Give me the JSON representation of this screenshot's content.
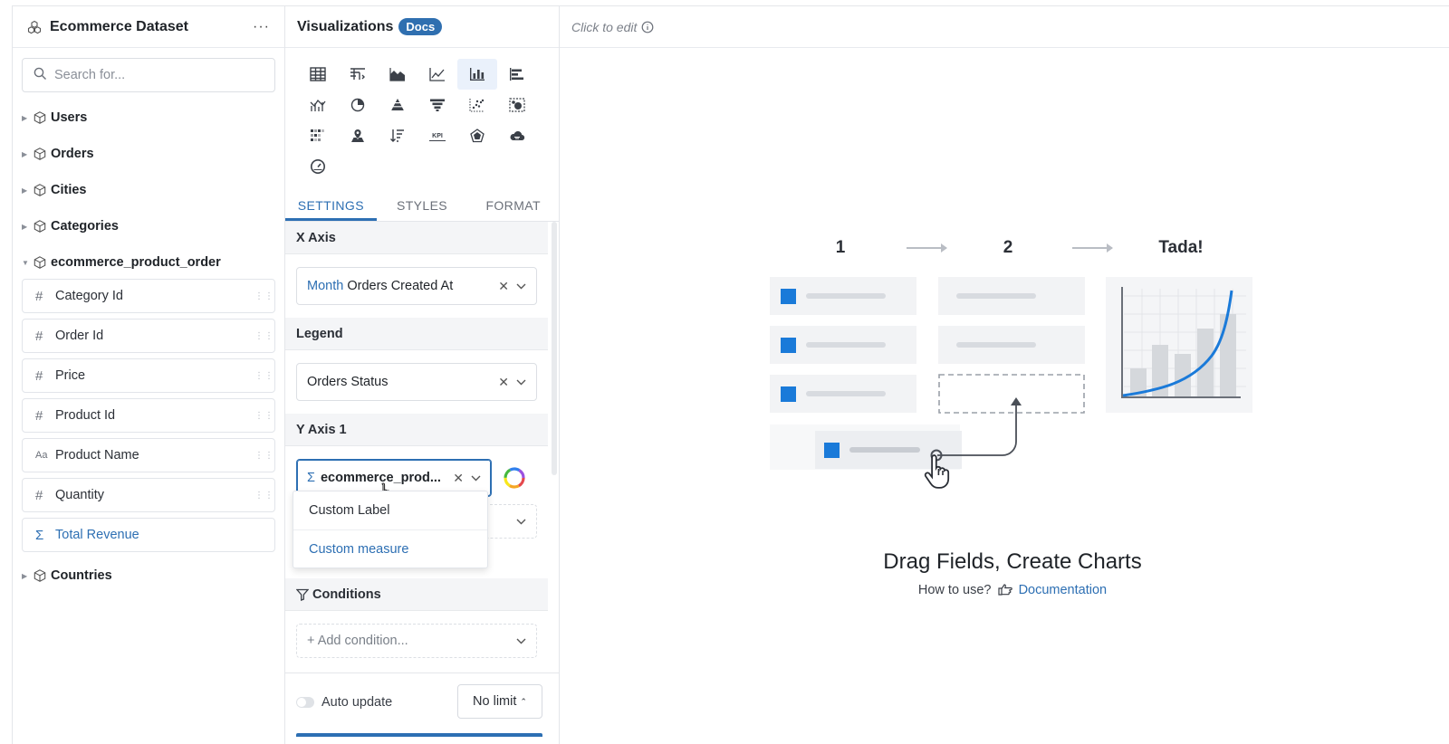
{
  "dataset": {
    "title": "Ecommerce Dataset",
    "more": "···",
    "search_placeholder": "Search for...",
    "models": [
      "Users",
      "Orders",
      "Cities",
      "Categories"
    ],
    "expanded_model": "ecommerce_product_order",
    "fields": [
      {
        "type": "#",
        "label": "Category Id"
      },
      {
        "type": "#",
        "label": "Order Id"
      },
      {
        "type": "#",
        "label": "Price"
      },
      {
        "type": "#",
        "label": "Product Id"
      },
      {
        "type": "Aa",
        "label": "Product Name"
      },
      {
        "type": "#",
        "label": "Quantity"
      }
    ],
    "measure": {
      "type": "Σ",
      "label": "Total Revenue"
    },
    "last_model": "Countries"
  },
  "viz": {
    "title": "Visualizations",
    "docs_badge": "Docs",
    "tabs": [
      "SETTINGS",
      "STYLES",
      "FORMAT"
    ],
    "x_axis": {
      "label": "X Axis",
      "granularity": "Month",
      "model": "Orders",
      "field": "Created At"
    },
    "legend": {
      "label": "Legend",
      "model": "Orders",
      "field": "Status"
    },
    "y_axis": {
      "label": "Y Axis 1",
      "sigma": "Σ",
      "value": "ecommerce_prod..."
    },
    "dropdown": [
      "Custom Label",
      "Custom measure"
    ],
    "conditions": {
      "label": "Conditions",
      "placeholder": "+ Add condition..."
    },
    "auto_update": "Auto update",
    "limit": "No limit"
  },
  "canvas": {
    "edit_hint": "Click to edit",
    "steps": [
      "1",
      "2",
      "Tada!"
    ],
    "title": "Drag Fields, Create Charts",
    "how_to": "How to use?",
    "doc_link": "Documentation"
  },
  "colors": {
    "accent": "#2d6fb3",
    "badge": "#2f6fb0",
    "illustration_blue": "#1a7ad9"
  }
}
